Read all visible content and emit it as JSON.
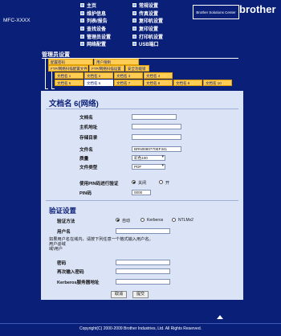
{
  "brand": "brother",
  "model": "MFC-XXXX",
  "solutions_center": "Brother Solutions Center",
  "menu_left": [
    {
      "label": "主页"
    },
    {
      "label": "维护信息"
    },
    {
      "label": "列表/报告"
    },
    {
      "label": "查找设备"
    },
    {
      "label": "管理员设置"
    },
    {
      "label": "网络配置"
    }
  ],
  "menu_right": [
    {
      "label": "常规设置"
    },
    {
      "label": "传真设置"
    },
    {
      "label": "复印机设置"
    },
    {
      "label": "复印设置"
    },
    {
      "label": "打印机设置"
    },
    {
      "label": "USB端口"
    }
  ],
  "admin": {
    "title": "管理员设置",
    "tabs_row1": [
      "配置密码",
      "用户限制"
    ],
    "tabs_row2": [
      "FTP/网络扫描配置文件",
      "FTP/网络扫描设置",
      "安全功能锁"
    ],
    "tabs_row3": [
      "文档名 1",
      "文档名 2",
      "文档名 3",
      "文档名 4"
    ],
    "tabs_row4": [
      "文档名 5",
      "文档名 6",
      "文档名 7",
      "文档名 8",
      "文档名 9",
      "文档名 10"
    ]
  },
  "form": {
    "heading": "文档名 6(网络)",
    "doc_name_label": "文档名",
    "host_label": "主机地址",
    "store_dir_label": "存储目录",
    "file_name_label": "文件名",
    "file_name_value": "BRN0080770EF341",
    "quality_label": "质量",
    "quality_value": "彩色100",
    "file_type_label": "文件类型",
    "file_type_value": "PDF",
    "pin_auth_label": "使用PIN码进行验证",
    "pin_off": "关闭",
    "pin_on": "开",
    "pin_code_label": "PIN码",
    "pin_code_value": "0000",
    "auth_section": "验证设置",
    "auth_method_label": "验证方法",
    "auth_auto": "自动",
    "auth_kerberos": "Kerberos",
    "auth_ntlm": "NTLMv2",
    "username_label": "用户名",
    "note_line1": "如果用户名在域内，请按下列任意一个格式输入用户名。",
    "note_line2": "用户@域",
    "note_line3": "域\\用户",
    "password_label": "密码",
    "repassword_label": "再次输入密码",
    "kerberos_label": "Kerberos服务器地址",
    "cancel_button": "取消",
    "submit_button": "提交"
  },
  "copyright": "Copyright(C) 2000-2009 Brother Industries, Ltd. All Rights Reserved."
}
